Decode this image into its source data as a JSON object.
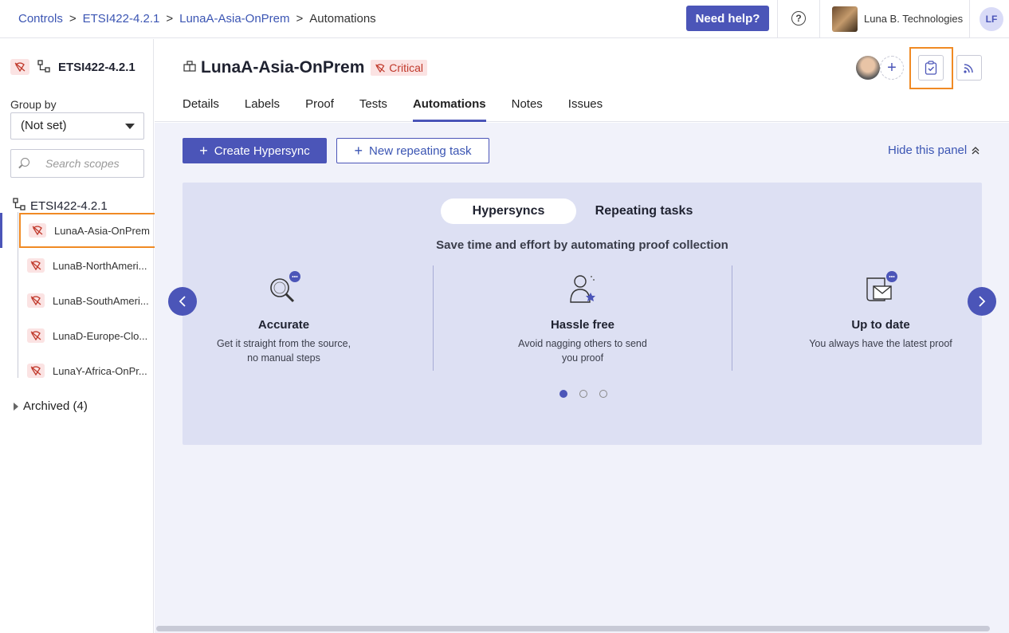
{
  "breadcrumbs": [
    {
      "label": "Controls"
    },
    {
      "label": "ETSI422-4.2.1"
    },
    {
      "label": "LunaA-Asia-OnPrem"
    },
    {
      "label": "Automations"
    }
  ],
  "header": {
    "help_label": "Need help?",
    "help_icon": "?",
    "org_name": "Luna B. Technologies",
    "user_initials": "LF"
  },
  "sidebar": {
    "title": "ETSI422-4.2.1",
    "group_by_label": "Group by",
    "group_by_value": "(Not set)",
    "search_placeholder": "Search scopes",
    "tree_root": "ETSI422-4.2.1",
    "items": [
      {
        "label": "LunaA-Asia-OnPrem"
      },
      {
        "label": "LunaB-NorthAmeri..."
      },
      {
        "label": "LunaB-SouthAmeri..."
      },
      {
        "label": "LunaD-Europe-Clo..."
      },
      {
        "label": "LunaY-Africa-OnPr..."
      }
    ],
    "archived_label": "Archived (4)"
  },
  "scope": {
    "name": "LunaA-Asia-OnPrem",
    "badge": "Critical"
  },
  "tabs": [
    {
      "label": "Details"
    },
    {
      "label": "Labels"
    },
    {
      "label": "Proof"
    },
    {
      "label": "Tests"
    },
    {
      "label": "Automations"
    },
    {
      "label": "Notes"
    },
    {
      "label": "Issues"
    }
  ],
  "toolbar": {
    "create_label": "Create Hypersync",
    "repeat_label": "New repeating task",
    "hide_label": "Hide this panel"
  },
  "panel": {
    "seg_hypersyncs": "Hypersyncs",
    "seg_repeating": "Repeating tasks",
    "subtitle": "Save time and effort by automating proof collection",
    "features": [
      {
        "title": "Accurate",
        "line1": "Get it straight from the source,",
        "line2": "no manual steps"
      },
      {
        "title": "Hassle free",
        "line1": "Avoid nagging others to send",
        "line2": "you proof"
      },
      {
        "title": "Up to date",
        "line1": "You always have the latest proof",
        "line2": ""
      }
    ],
    "active_dot": 1,
    "total_dots": 3
  },
  "colors": {
    "accent": "#4b55b8",
    "critical": "#c0392b",
    "highlight": "#f08a24",
    "panel_bg": "#dde0f3"
  }
}
